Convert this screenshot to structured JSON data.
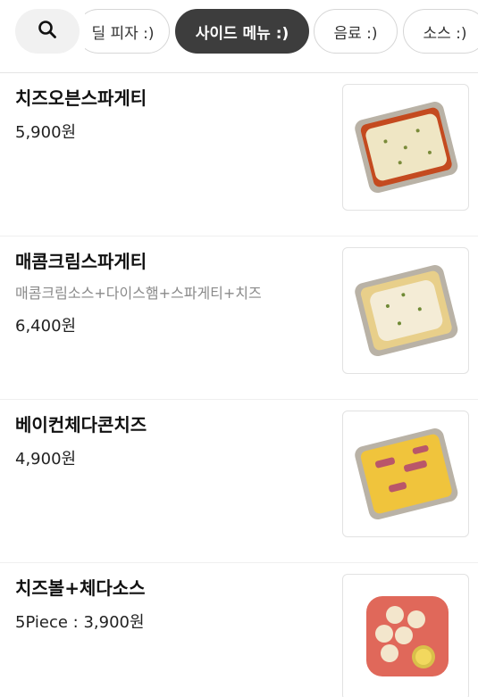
{
  "category_tabs": [
    {
      "label": "딜 피자 :)",
      "active": false
    },
    {
      "label": "사이드 메뉴 :)",
      "active": true
    },
    {
      "label": "음료 :)",
      "active": false
    },
    {
      "label": "소스 :)",
      "active": false
    }
  ],
  "menu_items": [
    {
      "name": "치즈오븐스파게티",
      "description": "",
      "price": "5,900원",
      "image_icon": "cheese-oven-spaghetti-tray-image"
    },
    {
      "name": "매콤크림스파게티",
      "description": "매콤크림소스+다이스햄+스파게티+치즈",
      "price": "6,400원",
      "image_icon": "spicy-cream-spaghetti-tray-image"
    },
    {
      "name": "베이컨체다콘치즈",
      "description": "",
      "price": "4,900원",
      "image_icon": "bacon-cheddar-corn-tray-image"
    },
    {
      "name": "치즈볼+체다소스",
      "description": "",
      "price": "5Piece : 3,900원",
      "image_icon": "cheese-balls-plate-image"
    }
  ],
  "colors": {
    "active_tab_bg": "#3d3d3d",
    "tab_border": "#d6d6d6",
    "search_bg": "#f1f1f1"
  }
}
